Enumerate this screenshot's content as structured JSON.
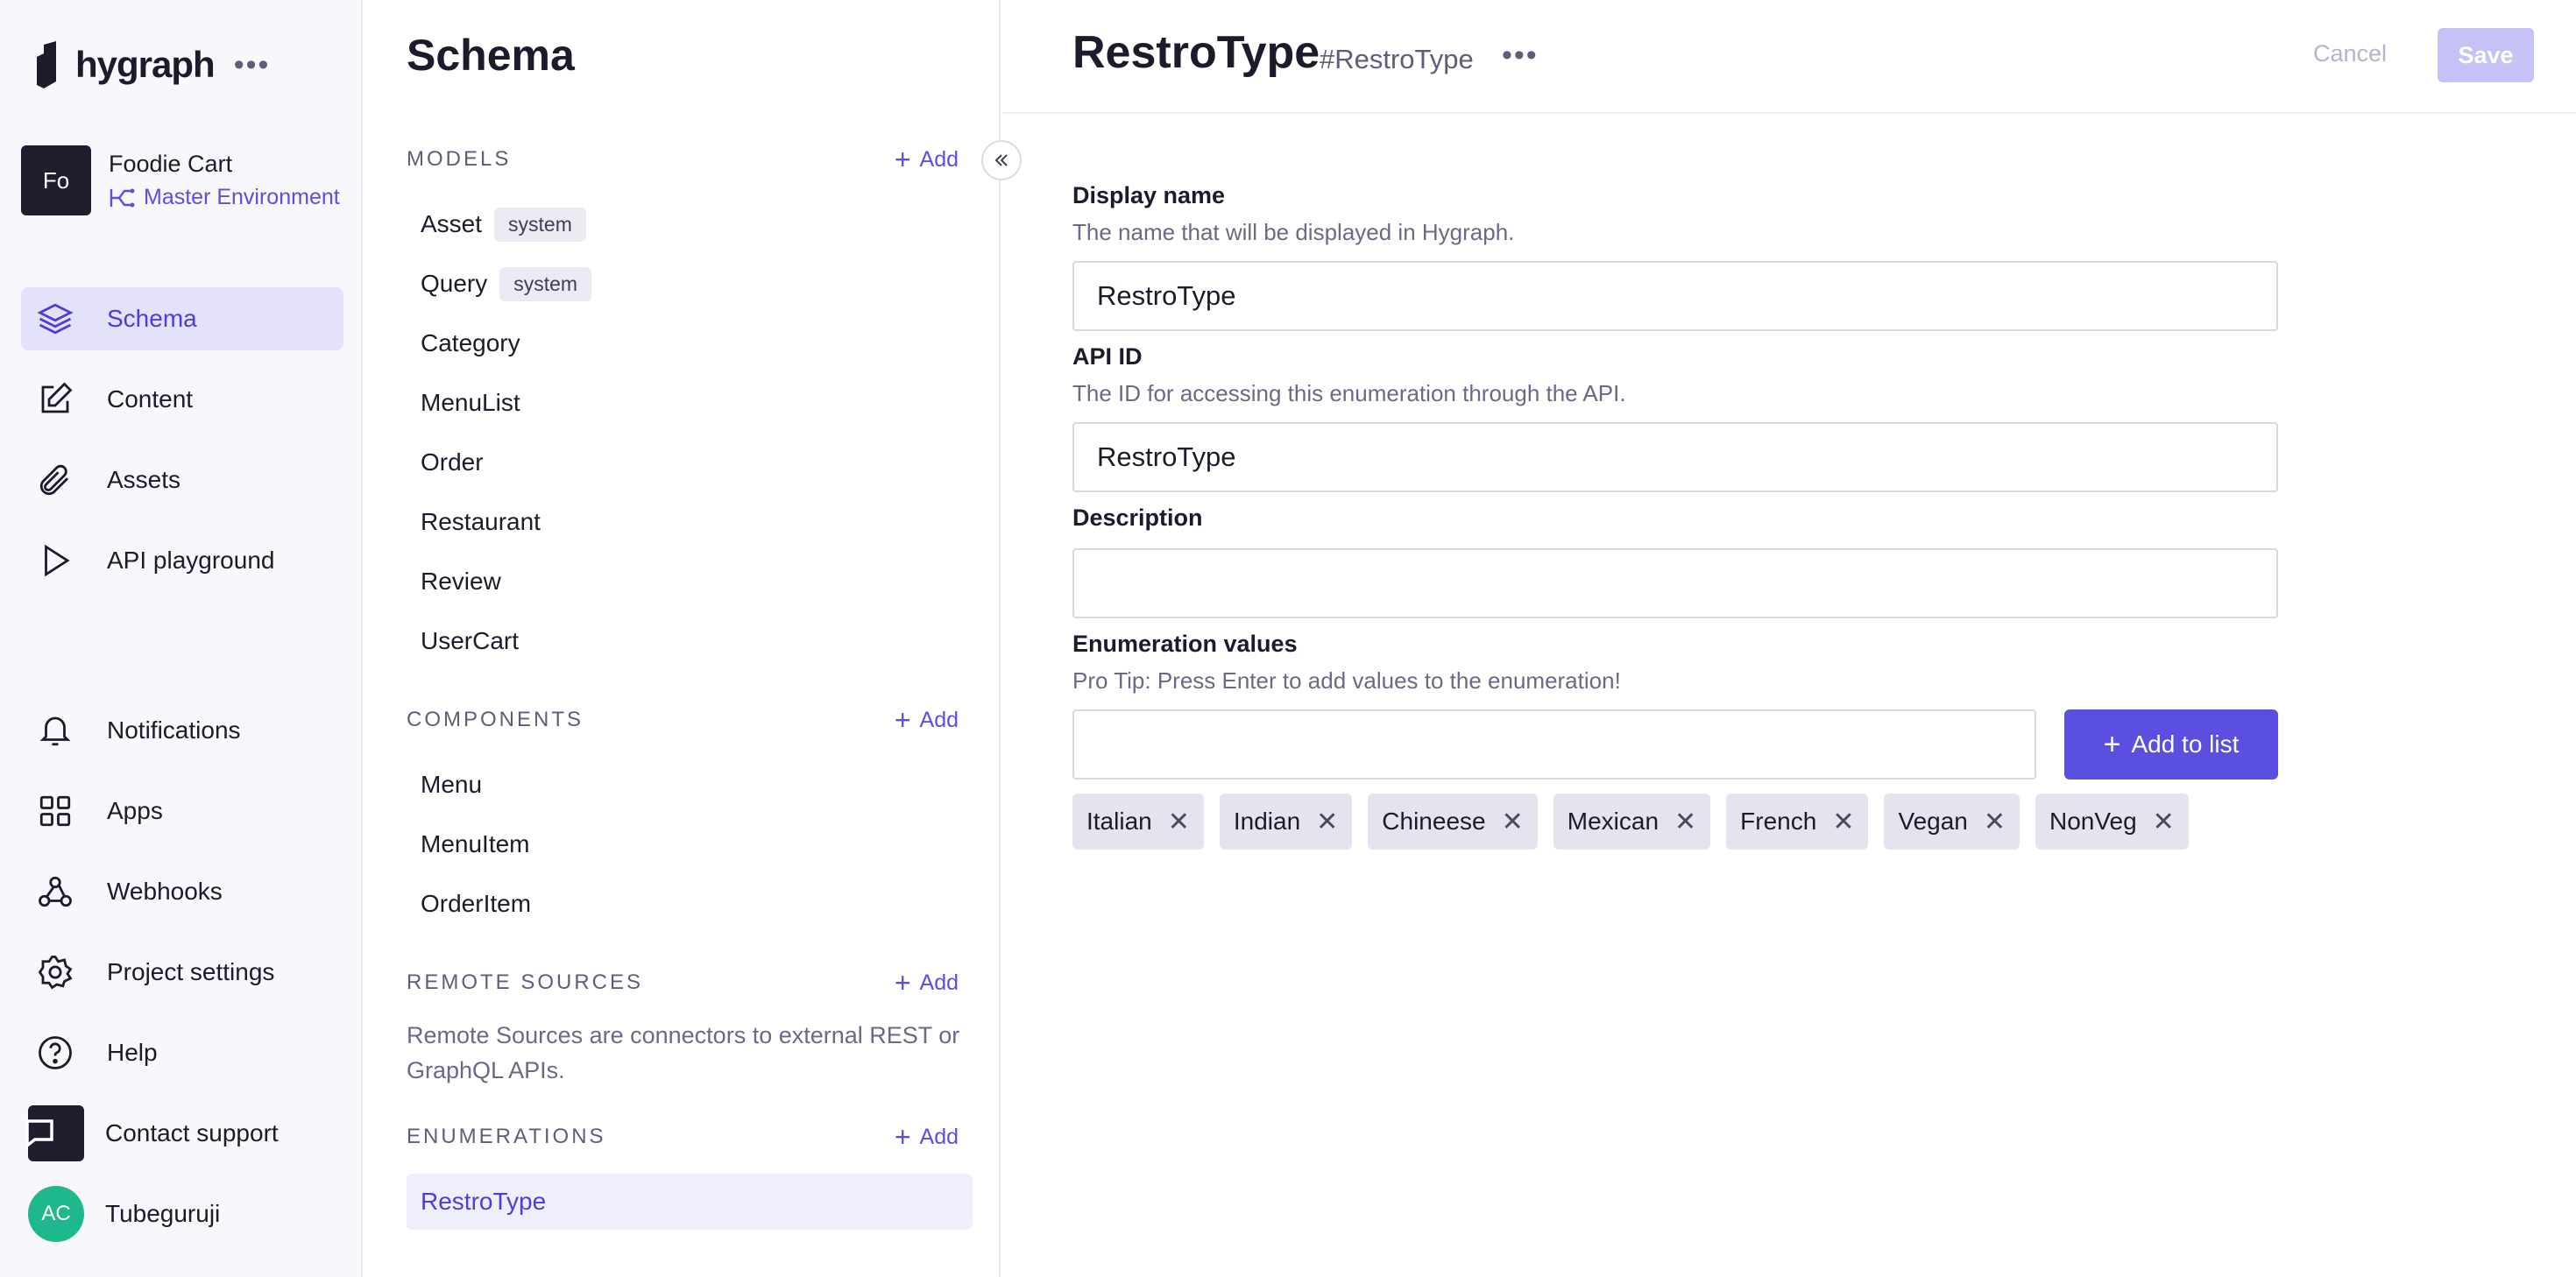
{
  "sidebar": {
    "logo": "hygraph",
    "logo_dots": "•••",
    "project": {
      "initials": "Fo",
      "name": "Foodie Cart",
      "environment": "Master Environment"
    },
    "nav": [
      {
        "label": "Schema",
        "icon": "layers-icon"
      },
      {
        "label": "Content",
        "icon": "edit-icon"
      },
      {
        "label": "Assets",
        "icon": "paperclip-icon"
      },
      {
        "label": "API playground",
        "icon": "play-icon"
      }
    ],
    "bottom_nav": [
      {
        "label": "Notifications",
        "icon": "bell-icon"
      },
      {
        "label": "Apps",
        "icon": "grid-icon"
      },
      {
        "label": "Webhooks",
        "icon": "webhook-icon"
      },
      {
        "label": "Project settings",
        "icon": "gear-icon"
      },
      {
        "label": "Help",
        "icon": "help-icon"
      },
      {
        "label": "Contact support",
        "icon": "chat-icon"
      }
    ],
    "user": {
      "initials": "AC",
      "name": "Tubeguruji"
    }
  },
  "schema": {
    "title": "Schema",
    "add_label": "Add",
    "models_label": "MODELS",
    "system_badge": "system",
    "models": [
      "Asset",
      "Query",
      "Category",
      "MenuList",
      "Order",
      "Restaurant",
      "Review",
      "UserCart"
    ],
    "components_label": "COMPONENTS",
    "components": [
      "Menu",
      "MenuItem",
      "OrderItem"
    ],
    "remote_label": "REMOTE SOURCES",
    "remote_desc": "Remote Sources are connectors to external REST or GraphQL APIs.",
    "enumerations_label": "ENUMERATIONS",
    "enumerations": [
      "RestroType"
    ]
  },
  "editor": {
    "title": "RestroType",
    "api_hash": "#RestroType",
    "dots": "•••",
    "cancel": "Cancel",
    "save": "Save",
    "display_name_label": "Display name",
    "display_name_hint": "The name that will be displayed in Hygraph.",
    "display_name_value": "RestroType",
    "api_id_label": "API ID",
    "api_id_hint": "The ID for accessing this enumeration through the API.",
    "api_id_value": "RestroType",
    "description_label": "Description",
    "description_value": "",
    "enum_values_label": "Enumeration values",
    "enum_values_hint": "Pro Tip: Press Enter to add values to the enumeration!",
    "enum_input_value": "",
    "add_to_list": "Add to list",
    "values": [
      "Italian",
      "Indian",
      "Chineese",
      "Mexican",
      "French",
      "Vegan",
      "NonVeg"
    ]
  },
  "colors": {
    "accent": "#5b4fe0",
    "save_disabled": "#c6c2f8",
    "active_nav_bg": "#e4e2fb"
  }
}
